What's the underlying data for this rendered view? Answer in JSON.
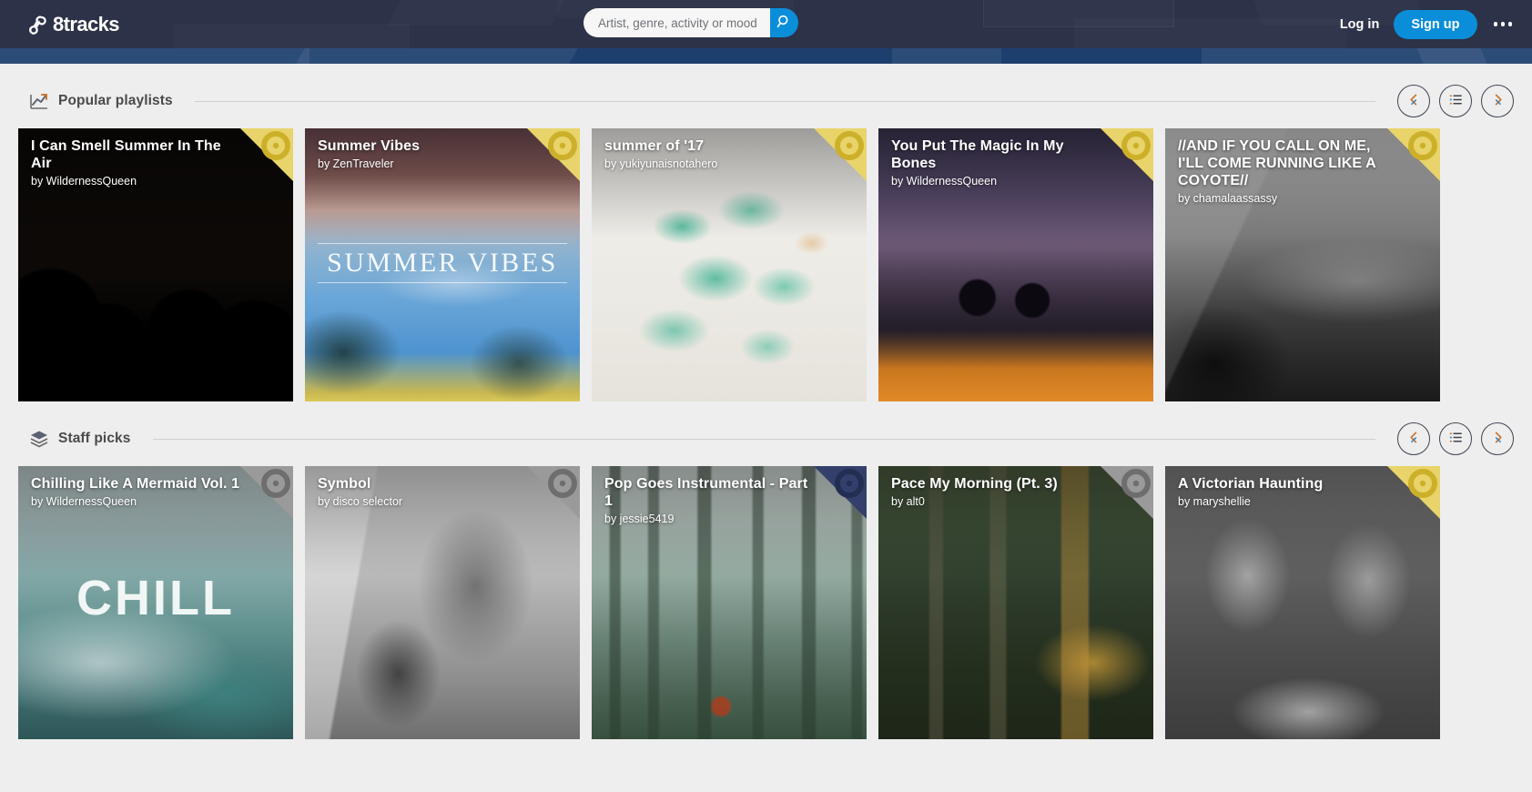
{
  "brand": {
    "name": "8tracks",
    "logo_icon": "8tracks-infinity-logo",
    "accent_blue": "#0b8ed9",
    "header_bg": "#2c3248",
    "hero_bg": "#1d3f6e"
  },
  "header": {
    "search": {
      "placeholder": "Artist, genre, activity or mood",
      "value": "",
      "button_icon": "search-icon"
    },
    "login_label": "Log in",
    "signup_label": "Sign up",
    "more_icon": "ellipsis-icon"
  },
  "sections": [
    {
      "id": "popular-playlists",
      "title": "Popular playlists",
      "icon": "trending-up-icon",
      "controls": {
        "prev_icon": "chevron-left-icon",
        "list_icon": "list-icon",
        "next_icon": "chevron-right-icon"
      },
      "cards": [
        {
          "title": "I Can Smell Summer In The Air",
          "by": "by WildernessQueen",
          "badge": "yellow-disc-badge",
          "art": "art-palms"
        },
        {
          "title": "Summer Vibes",
          "by": "by ZenTraveler",
          "badge": "yellow-disc-badge",
          "art": "art-vibes",
          "overlay_text": "SUMMER VIBES"
        },
        {
          "title": "summer of '17",
          "by": "by yukiyunaisnotahero",
          "badge": "yellow-disc-badge",
          "art": "art-glass"
        },
        {
          "title": "You Put The Magic In My Bones",
          "by": "by WildernessQueen",
          "badge": "yellow-disc-badge",
          "art": "art-city"
        },
        {
          "title": "//AND IF YOU CALL ON ME, I'LL COME RUNNING LIKE A COYOTE//",
          "by": "by chamalaassassy",
          "badge": "yellow-disc-badge",
          "art": "art-coast"
        }
      ]
    },
    {
      "id": "staff-picks",
      "title": "Staff picks",
      "icon": "layers-icon",
      "controls": {
        "prev_icon": "chevron-left-icon",
        "list_icon": "list-icon",
        "next_icon": "chevron-right-icon"
      },
      "cards": [
        {
          "title": "Chilling Like A Mermaid Vol. 1",
          "by": "by WildernessQueen",
          "badge": "grey-disc-badge",
          "art": "art-wave",
          "overlay_text": "CHILL"
        },
        {
          "title": "Symbol",
          "by": "by disco selector",
          "badge": "grey-disc-badge",
          "art": "art-statue"
        },
        {
          "title": "Pop Goes Instrumental - Part 1",
          "by": "by jessie5419",
          "badge": "navy-disc-badge",
          "art": "art-forest"
        },
        {
          "title": "Pace My Morning (Pt. 3)",
          "by": "by alt0",
          "badge": "grey-disc-badge",
          "art": "art-house"
        },
        {
          "title": "A Victorian Haunting",
          "by": "by maryshellie",
          "badge": "yellow-disc-badge",
          "art": "art-victorian"
        }
      ]
    }
  ]
}
